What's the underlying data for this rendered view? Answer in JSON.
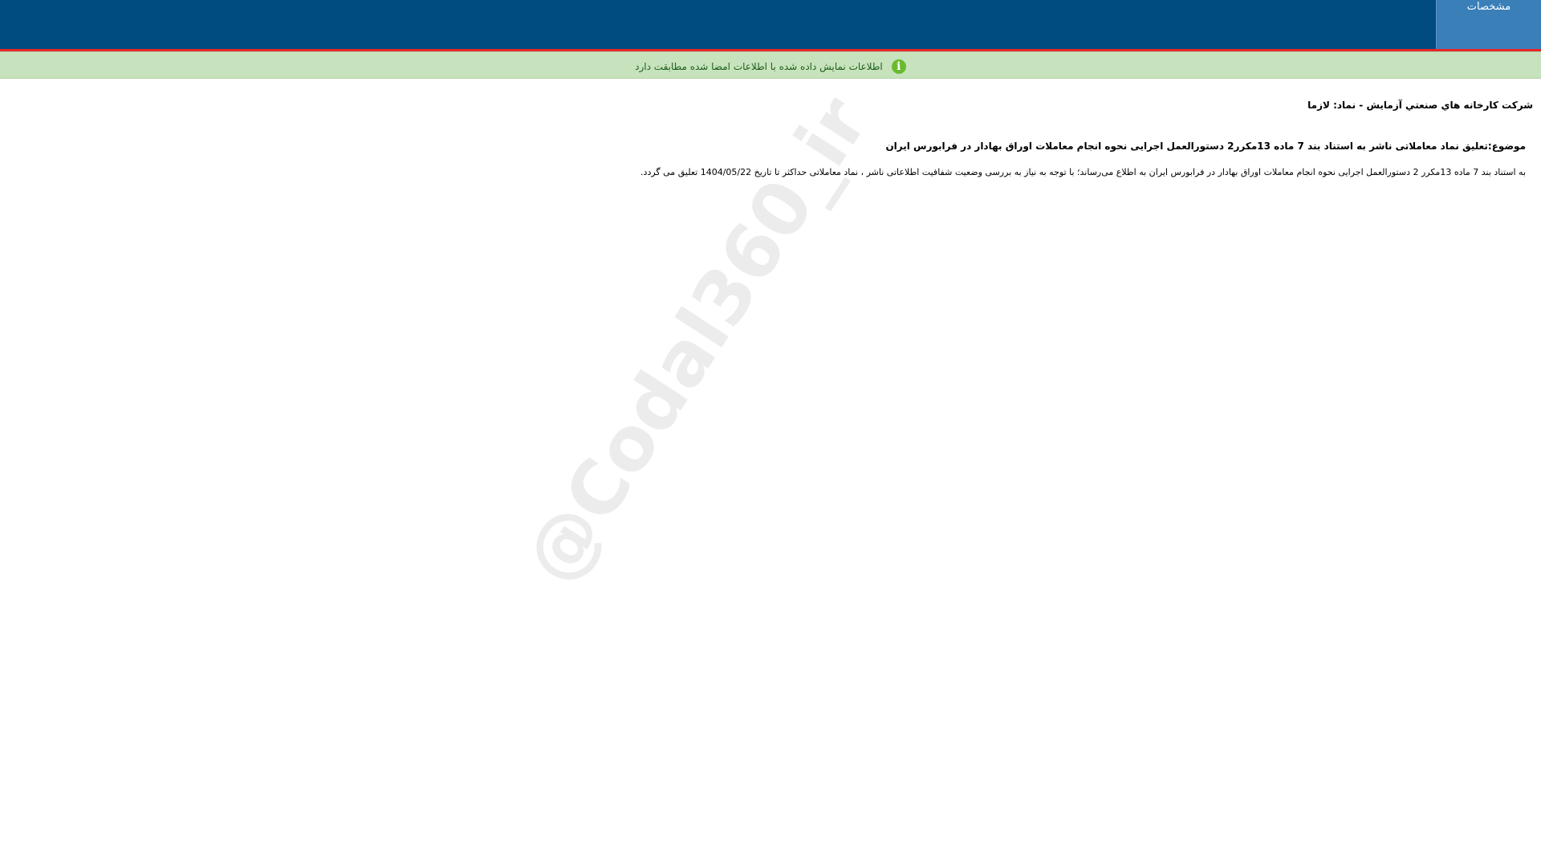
{
  "header": {
    "tab_label": "مشخصات",
    "bg_color": "#004b80",
    "accent_color": "#e8262a",
    "tab_color": "#3a7fb8"
  },
  "notice": {
    "icon": "info-icon",
    "icon_glyph": "i",
    "text": "اطلاعات نمایش داده شده با اطلاعات امضا شده مطابقت دارد",
    "bg_color": "#c7e3bd"
  },
  "announcement": {
    "company_line": "شرکت کارخانه هاي صنعتي آزمايش - نماد: لازما",
    "subject": "موضوع:تعلیق نماد معاملاتی ناشر به استناد بند 7 ماده 13مکرر2 دستورالعمل اجرایی نحوه انجام معاملات اوراق بهادار در فرابورس ایران",
    "body": "به استناد بند 7 ماده 13مکرر 2 دستورالعمل اجرایی نحوه انجام معاملات اوراق بهادار در فرابورس ایران به اطلاع می‌رساند؛ با توجه به نیاز به بررسی وضعیت شفافیت اطلاعاتی ناشر ، نماد معاملاتی حداکثر تا تاریخ 1404/05/22 تعلیق می گردد."
  },
  "watermark": {
    "text": "@Codal360_ir"
  }
}
